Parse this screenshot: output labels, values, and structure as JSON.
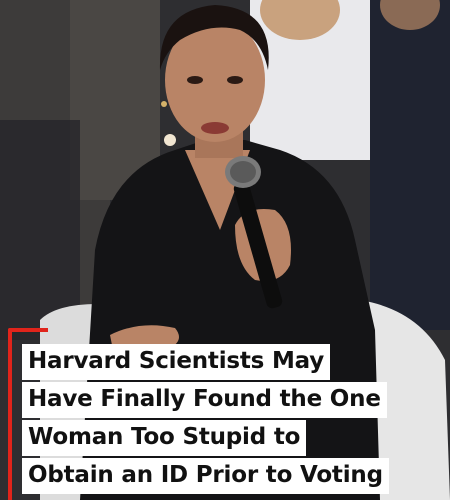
{
  "photo": {
    "alt": "",
    "colors": {
      "background": "#3a3a3c",
      "jacket": "#141416",
      "skin": "#b98466",
      "hair": "#1a1210",
      "microphone": "#0d0d0d",
      "chair": "#e6e6e6"
    }
  },
  "headline": {
    "lines": [
      "Harvard Scientists May",
      "Have Finally Found the One",
      "Woman Too Stupid to",
      "Obtain an ID Prior to Voting"
    ]
  },
  "colors": {
    "accent": "#e0241b",
    "caption_bg": "#ffffff",
    "caption_text": "#111111"
  }
}
